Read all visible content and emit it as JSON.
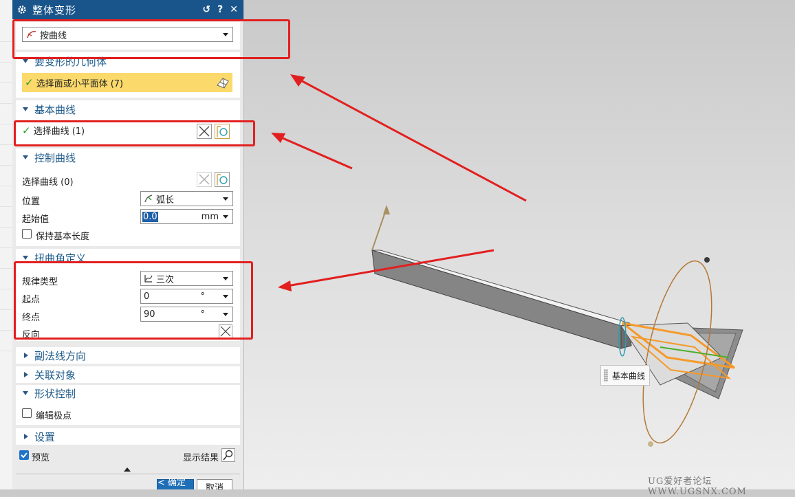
{
  "dialog": {
    "title": "整体变形",
    "title_icons": {
      "reset": "↺",
      "help": "?",
      "close": "✕"
    },
    "type_select": {
      "value": "按曲线"
    },
    "sections": {
      "geometry": {
        "label": "要变形的几何体",
        "select_text": "选择面或小平面体 (7)"
      },
      "base_curve": {
        "label": "基本曲线",
        "select_text": "选择曲线 (1)"
      },
      "control_curve": {
        "label": "控制曲线",
        "select_text": "选择曲线 (0)",
        "position_label": "位置",
        "position_value": "弧长",
        "start_label": "起始值",
        "start_value": "0.0",
        "start_unit": "mm",
        "keep_length_label": "保持基本长度"
      },
      "twist": {
        "label": "扭曲角定义",
        "law_label": "规律类型",
        "law_value": "三次",
        "start_label": "起点",
        "start_value": "0",
        "start_unit": "°",
        "end_label": "终点",
        "end_value": "90",
        "end_unit": "°",
        "reverse_label": "反向"
      },
      "binormal": {
        "label": "副法线方向"
      },
      "associated": {
        "label": "关联对象"
      },
      "shape": {
        "label": "形状控制",
        "edit_poles_label": "编辑极点"
      },
      "settings": {
        "label": "设置"
      }
    },
    "preview_label": "预览",
    "show_result_label": "显示结果",
    "ok_label": "< 确定 >",
    "cancel_label": "取消"
  },
  "viewport": {
    "curve_tag": "基本曲线",
    "watermark": "UG爱好者论坛 WWW.UGSNX.COM"
  },
  "colors": {
    "titlebar": "#19558a",
    "section_label": "#1c5a8a",
    "selected_row": "#fbd96b",
    "annotation_red": "#e21f1f",
    "highlight_orange": "#f59a2a"
  }
}
